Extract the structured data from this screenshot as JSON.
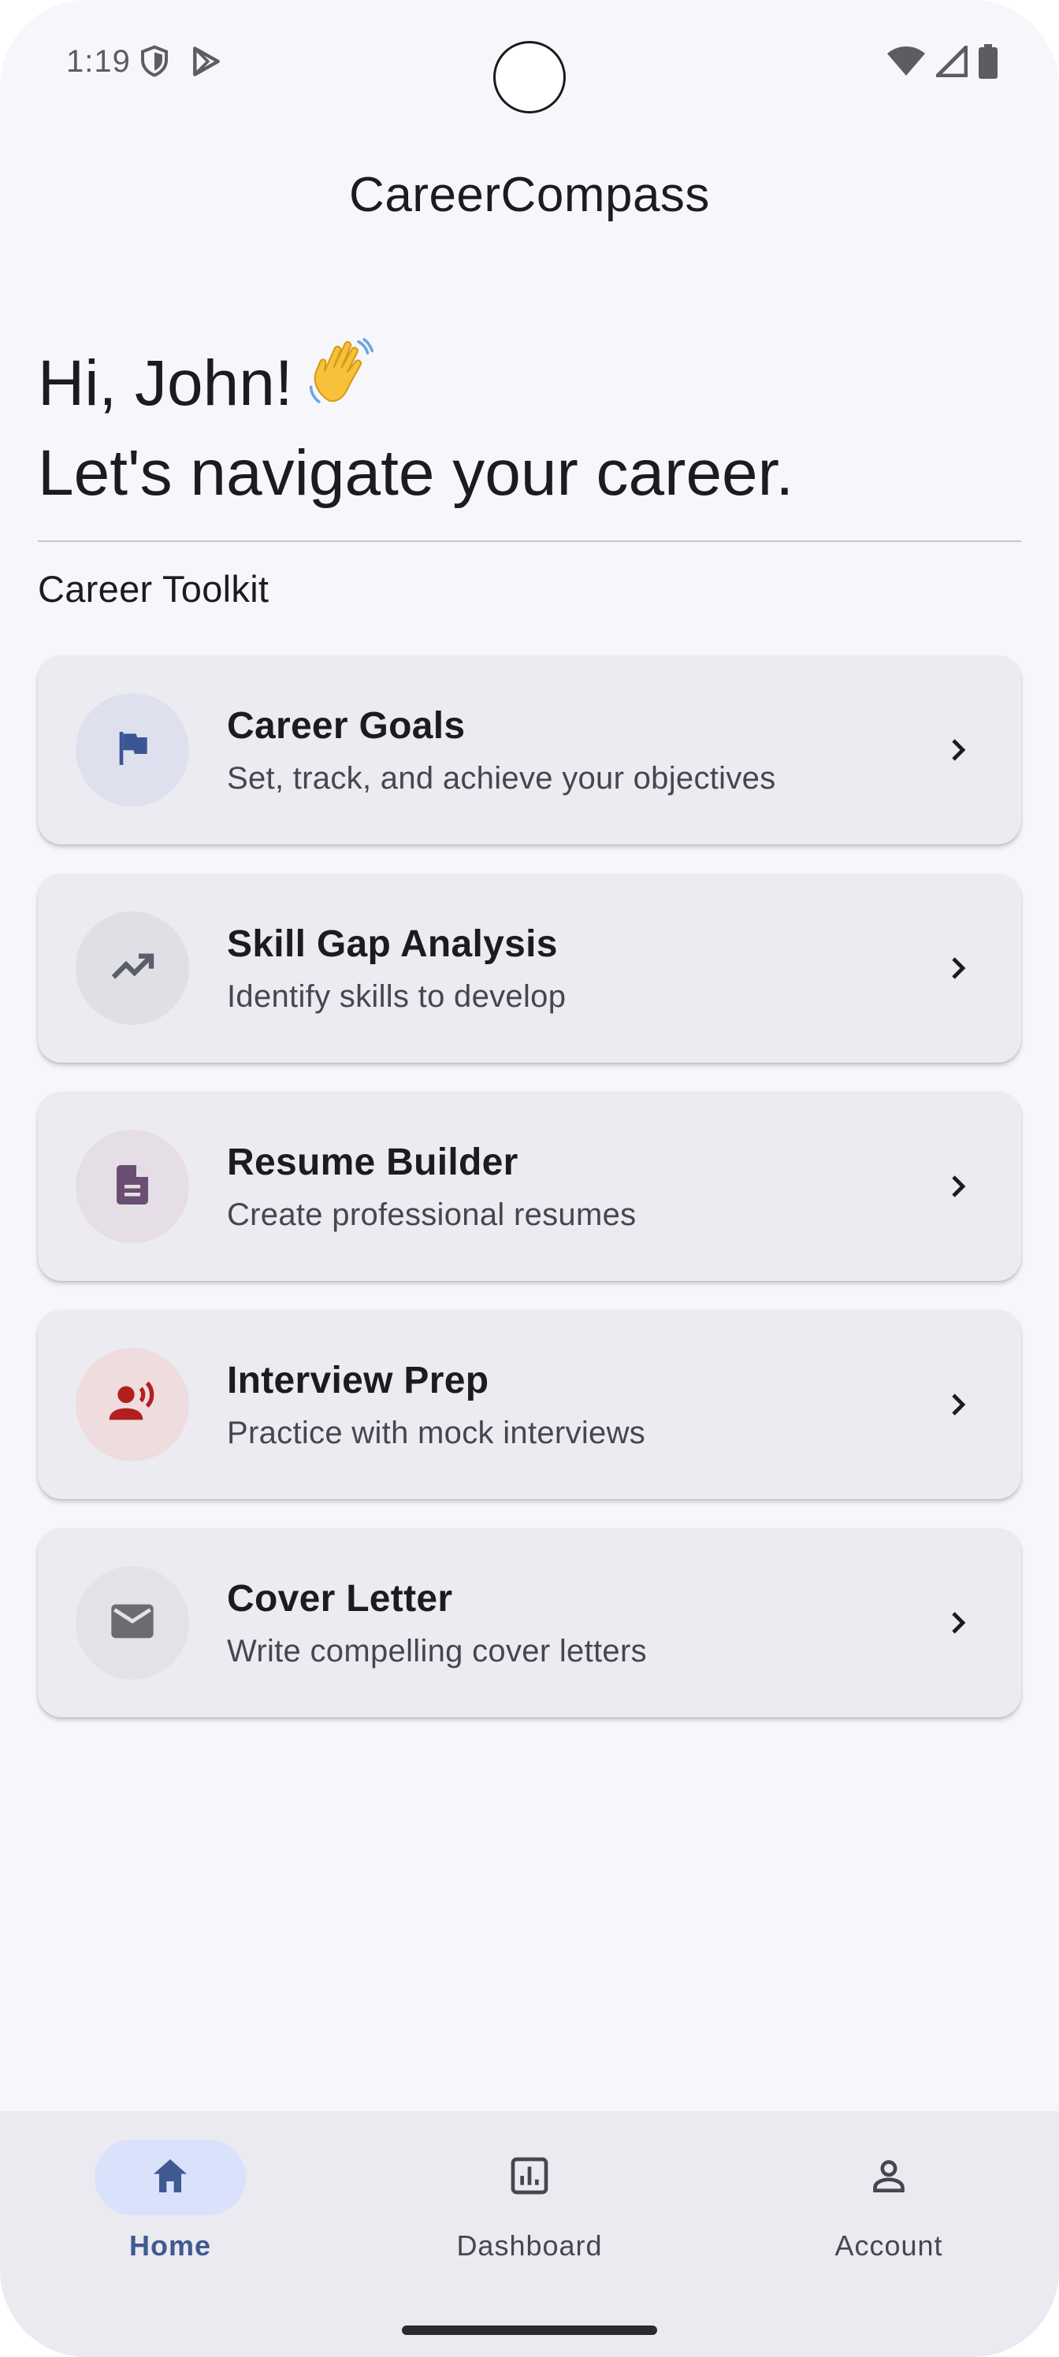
{
  "status_bar": {
    "time": "1:19"
  },
  "app_title": "CareerCompass",
  "greeting": {
    "line1": "Hi, John!",
    "emoji": "👋",
    "line2": "Let's navigate your career."
  },
  "section_title": "Career Toolkit",
  "cards": [
    {
      "title": "Career Goals",
      "subtitle": "Set, track, and achieve your objectives",
      "icon": "flag-icon",
      "icon_color": "#3b5694",
      "icon_bg": "#dfe0ee"
    },
    {
      "title": "Skill Gap Analysis",
      "subtitle": "Identify skills to develop",
      "icon": "trending-up-icon",
      "icon_color": "#5a5e6c",
      "icon_bg": "#e0dfe5"
    },
    {
      "title": "Resume Builder",
      "subtitle": "Create professional resumes",
      "icon": "document-icon",
      "icon_color": "#6b4f73",
      "icon_bg": "#e5dee6"
    },
    {
      "title": "Interview Prep",
      "subtitle": "Practice with mock interviews",
      "icon": "voice-person-icon",
      "icon_color": "#b1201e",
      "icon_bg": "#efdcdf"
    },
    {
      "title": "Cover Letter",
      "subtitle": "Write compelling cover letters",
      "icon": "mail-icon",
      "icon_color": "#6b6b72",
      "icon_bg": "#e3e2e8"
    }
  ],
  "bottom_nav": {
    "items": [
      {
        "label": "Home",
        "icon": "home-icon",
        "active": true
      },
      {
        "label": "Dashboard",
        "icon": "dashboard-chart-icon",
        "active": false
      },
      {
        "label": "Account",
        "icon": "person-icon",
        "active": false
      }
    ]
  },
  "colors": {
    "background": "#f7f6fb",
    "card": "#ecebf1",
    "accent": "#3f5a91",
    "active_pill": "#d9e1fb"
  }
}
